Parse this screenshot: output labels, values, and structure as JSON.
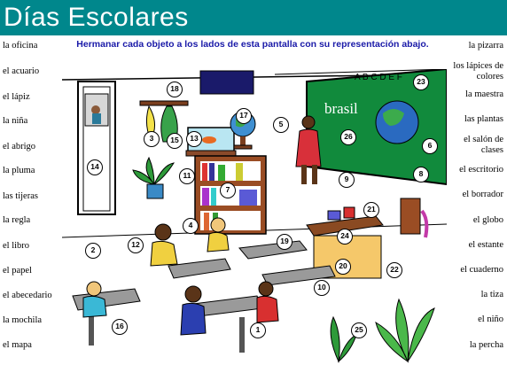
{
  "title": "Días Escolares",
  "instructions": "Hermanar cada objeto a los lados de esta pantalla con su representación abajo.",
  "left_words": [
    "la oficina",
    "el acuario",
    "el lápiz",
    "la niña",
    "el abrigo",
    "la pluma",
    "las tijeras",
    "la regla",
    "el libro",
    "el papel",
    "el abecedario",
    "la mochila",
    "el mapa"
  ],
  "right_words": [
    "la pizarra",
    "los lápices de colores",
    "la maestra",
    "las plantas",
    "el salón de clases",
    "el escritorio",
    "el borrador",
    "el globo",
    "el estante",
    "el cuaderno",
    "la tiza",
    "el niño",
    "la percha"
  ],
  "board_text": "brasil",
  "board_letters": "A B C D E F",
  "numbers": [
    "1",
    "2",
    "3",
    "4",
    "5",
    "6",
    "7",
    "8",
    "9",
    "10",
    "11",
    "12",
    "13",
    "14",
    "15",
    "16",
    "17",
    "18",
    "19",
    "20",
    "21",
    "22",
    "23",
    "24",
    "25",
    "26"
  ],
  "colors": {
    "title_bar": "#00878c",
    "instructions": "#1a1aa8",
    "board": "#118a3c",
    "wall": "#ffffff"
  }
}
